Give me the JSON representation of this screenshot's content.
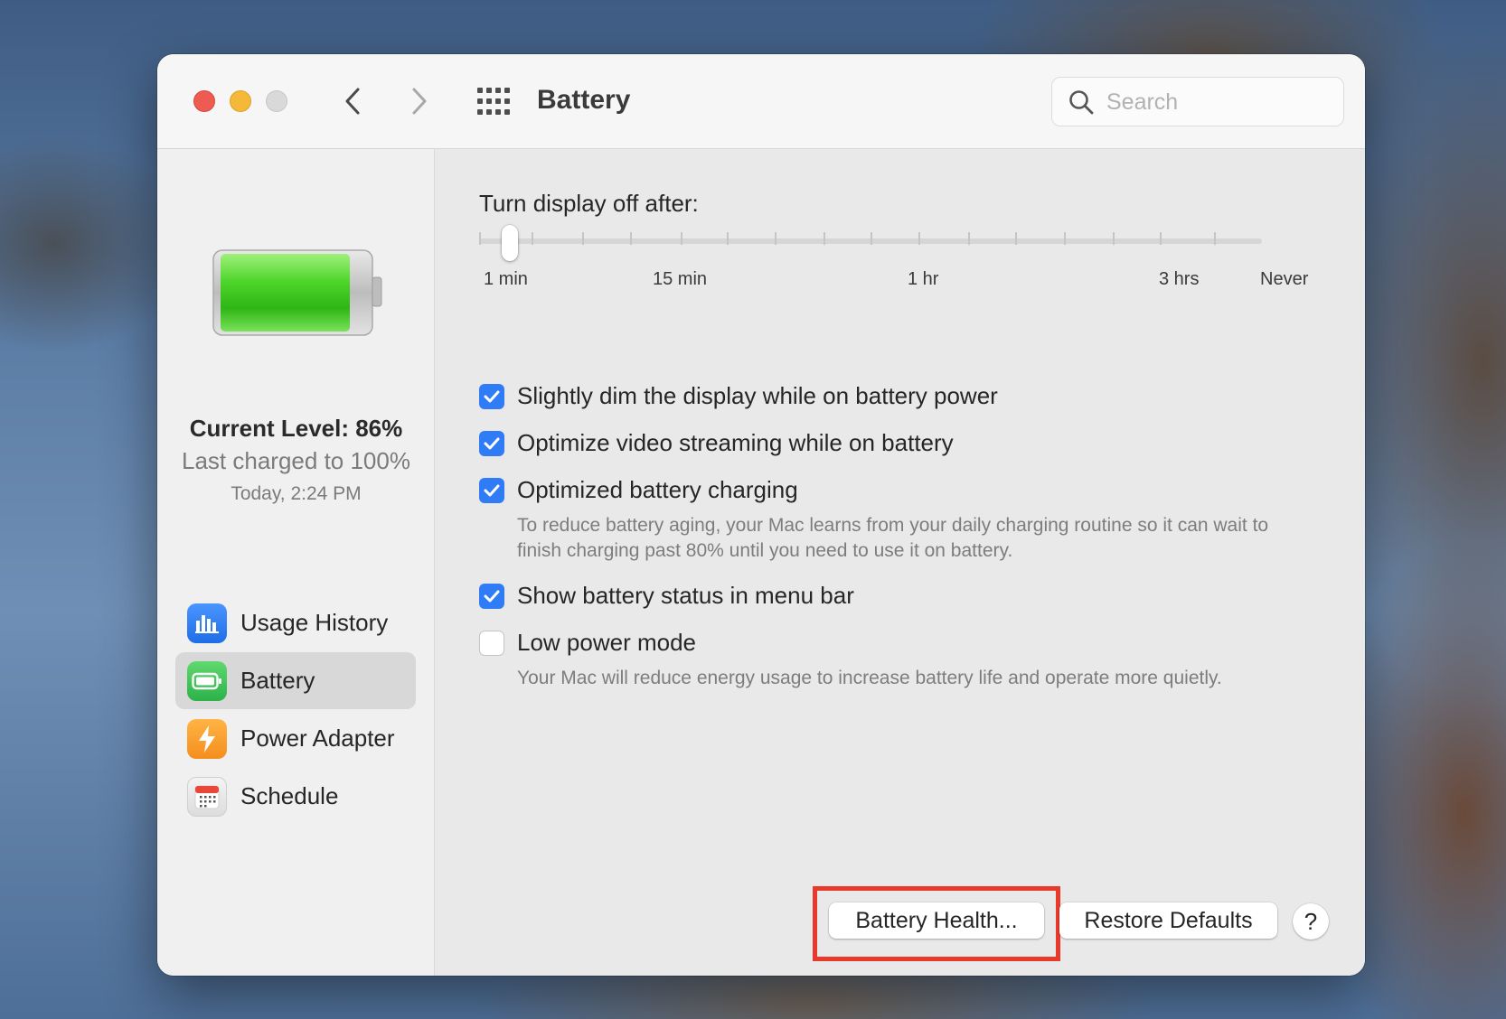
{
  "window": {
    "title": "Battery",
    "search_placeholder": "Search"
  },
  "sidebar": {
    "current_level": "Current Level: 86%",
    "last_charged": "Last charged to 100%",
    "charged_time": "Today, 2:24 PM",
    "battery_level_fraction": 0.86,
    "items": [
      {
        "label": "Usage History",
        "icon": "bar-chart-icon",
        "color": "#2f7cf6"
      },
      {
        "label": "Battery",
        "icon": "battery-icon",
        "color": "#35c759",
        "selected": true
      },
      {
        "label": "Power Adapter",
        "icon": "lightning-bolt-icon",
        "color": "#f7a531"
      },
      {
        "label": "Schedule",
        "icon": "calendar-icon",
        "color": "#e04a3a"
      }
    ]
  },
  "display_slider": {
    "title": "Turn display off after:",
    "labels": [
      "1 min",
      "15 min",
      "1 hr",
      "3 hrs",
      "Never"
    ],
    "value": "1 min"
  },
  "options": [
    {
      "label": "Slightly dim the display while on battery power",
      "checked": true
    },
    {
      "label": "Optimize video streaming while on battery",
      "checked": true
    },
    {
      "label": "Optimized battery charging",
      "checked": true,
      "description": "To reduce battery aging, your Mac learns from your daily charging routine so it can wait to finish charging past 80% until you need to use it on battery."
    },
    {
      "label": "Show battery status in menu bar",
      "checked": true
    },
    {
      "label": "Low power mode",
      "checked": false,
      "description": "Your Mac will reduce energy usage to increase battery life and operate more quietly."
    }
  ],
  "footer": {
    "battery_health_label": "Battery Health...",
    "restore_defaults_label": "Restore Defaults",
    "help_label": "?"
  },
  "colors": {
    "accent": "#2f7cf6",
    "highlight": "#e8392a"
  }
}
